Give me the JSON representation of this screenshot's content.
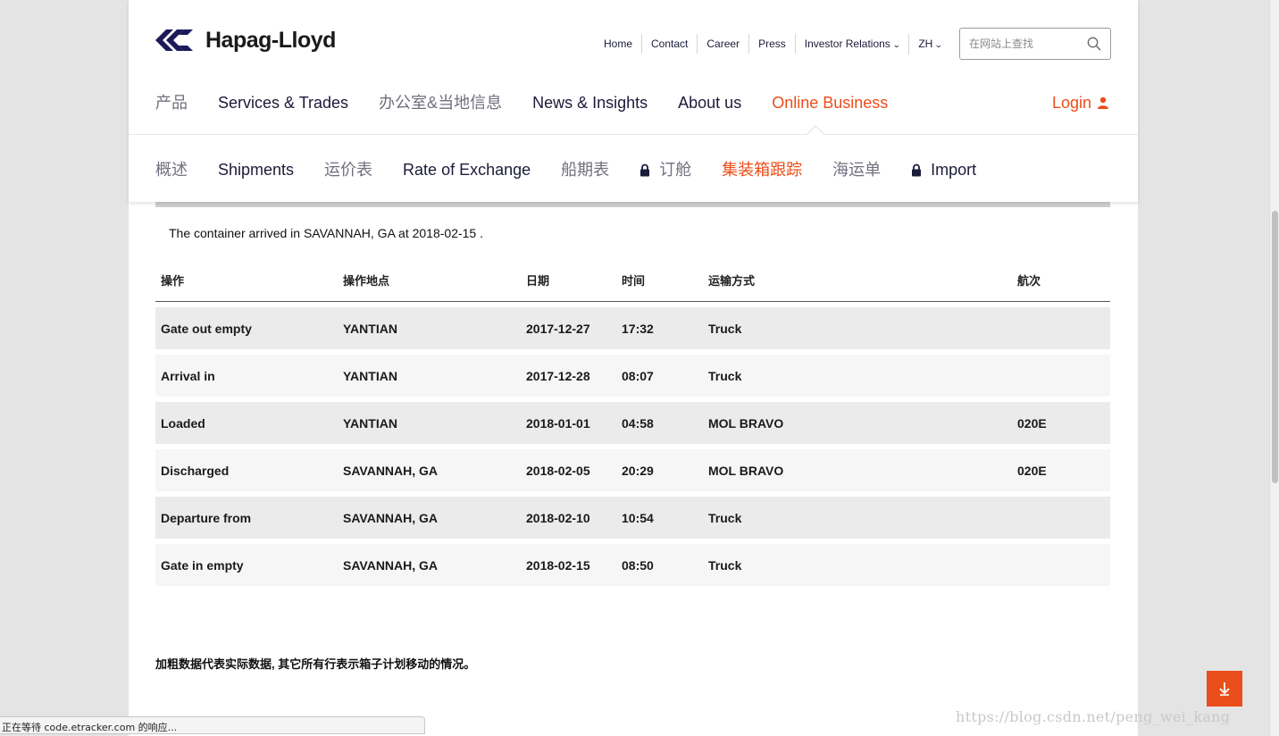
{
  "brand": {
    "name": "Hapag-Lloyd",
    "accent": "#ea4e1a",
    "navy": "#1b1b3a"
  },
  "topnav": [
    {
      "label": "Home"
    },
    {
      "label": "Contact"
    },
    {
      "label": "Career"
    },
    {
      "label": "Press"
    },
    {
      "label": "Investor Relations",
      "dropdown": true
    },
    {
      "label": "ZH",
      "dropdown": true
    }
  ],
  "search": {
    "placeholder": "在网站上查找",
    "icon": "search-icon"
  },
  "mainnav": [
    {
      "label": "产品",
      "cn": true
    },
    {
      "label": "Services & Trades"
    },
    {
      "label": "办公室&当地信息",
      "cn": true
    },
    {
      "label": "News & Insights"
    },
    {
      "label": "About us"
    },
    {
      "label": "Online Business",
      "active": true
    }
  ],
  "login": {
    "label": "Login",
    "icon": "user-icon"
  },
  "subnav": [
    {
      "label": "概述",
      "cn": true
    },
    {
      "label": "Shipments"
    },
    {
      "label": "运价表",
      "cn": true
    },
    {
      "label": "Rate of Exchange"
    },
    {
      "label": "船期表",
      "cn": true
    },
    {
      "label": "订舱",
      "cn": true,
      "locked": true
    },
    {
      "label": "集装箱跟踪",
      "active": true
    },
    {
      "label": "海运单",
      "cn": true
    },
    {
      "label": "Import",
      "locked": true
    }
  ],
  "tracking": {
    "arrived_text": "The container arrived in SAVANNAH, GA at 2018-02-15 .",
    "headers": [
      "操作",
      "操作地点",
      "日期",
      "时间",
      "运输方式",
      "航次"
    ],
    "rows": [
      [
        "Gate out empty",
        "YANTIAN",
        "2017-12-27",
        "17:32",
        "Truck",
        ""
      ],
      [
        "Arrival in",
        "YANTIAN",
        "2017-12-28",
        "08:07",
        "Truck",
        ""
      ],
      [
        "Loaded",
        "YANTIAN",
        "2018-01-01",
        "04:58",
        "MOL BRAVO",
        "020E"
      ],
      [
        "Discharged",
        "SAVANNAH, GA",
        "2018-02-05",
        "20:29",
        "MOL BRAVO",
        "020E"
      ],
      [
        "Departure from",
        "SAVANNAH, GA",
        "2018-02-10",
        "10:54",
        "Truck",
        ""
      ],
      [
        "Gate in empty",
        "SAVANNAH, GA",
        "2018-02-15",
        "08:50",
        "Truck",
        ""
      ]
    ],
    "note": "加粗数据代表实际数据, 其它所有行表示箱子计划移动的情况。"
  },
  "statusbar": {
    "text": "正在等待 code.etracker.com 的响应..."
  },
  "watermark": {
    "text": "https://blog.csdn.net/peng_wei_kang"
  }
}
